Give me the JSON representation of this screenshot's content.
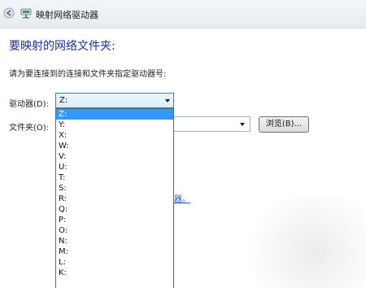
{
  "window": {
    "title": "映射网络驱动器",
    "back_icon": "back-arrow-icon",
    "app_icon": "network-drive-icon"
  },
  "main": {
    "heading": "要映射的网络文件夹:",
    "instruction": "请为要连接到的连接和文件夹指定驱动器号:",
    "drive_label": "驱动器(D):",
    "drive_value": "Z:",
    "folder_label": "文件夹(O):",
    "folder_value": "",
    "browse_label": "浏览(B)...",
    "link_fragment": "器。"
  },
  "dropdown": {
    "options": [
      "Z:",
      "Y:",
      "X:",
      "W:",
      "V:",
      "U:",
      "T:",
      "S:",
      "R:",
      "Q:",
      "P:",
      "O:",
      "N:",
      "M:",
      "L:",
      "K:"
    ],
    "selected": "Z:"
  },
  "colors": {
    "heading": "#1e3287",
    "selection": "#3399ff",
    "focus_border": "#3c7fb1"
  }
}
